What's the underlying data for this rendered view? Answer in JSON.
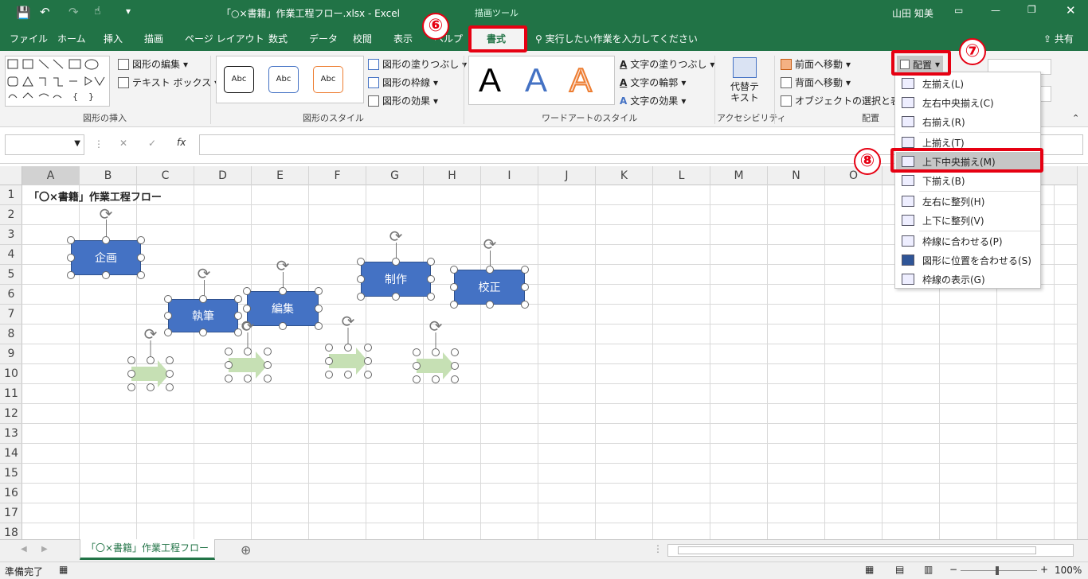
{
  "titlebar": {
    "filename": "「○×書籍」作業工程フロー.xlsx",
    "sep": "-",
    "app": "Excel",
    "context_tool": "描画ツール",
    "user": "山田 知美"
  },
  "tabs": [
    "ファイル",
    "ホーム",
    "挿入",
    "描画",
    "ページ レイアウト",
    "数式",
    "データ",
    "校閲",
    "表示",
    "ヘルプ",
    "書式"
  ],
  "tell_me": "実行したい作業を入力してください",
  "share": "共有",
  "ribbon": {
    "insert_shapes": {
      "edit_shape": "図形の編集",
      "text_box": "テキスト ボックス",
      "label": "図形の挿入"
    },
    "shape_styles": {
      "style_samples": [
        "Abc",
        "Abc",
        "Abc"
      ],
      "fill": "図形の塗りつぶし",
      "outline": "図形の枠線",
      "effects": "図形の効果",
      "label": "図形のスタイル"
    },
    "wordart": {
      "samples": [
        "A",
        "A",
        "A"
      ],
      "fill": "文字の塗りつぶし",
      "outline": "文字の輪郭",
      "effects": "文字の効果",
      "label": "ワードアートのスタイル"
    },
    "accessibility": {
      "alt_text": "代替テキスト",
      "label": "アクセシビリティ"
    },
    "arrange": {
      "bring_forward": "前面へ移動",
      "send_backward": "背面へ移動",
      "selection_pane": "オブジェクトの選択と表示",
      "align": "配置",
      "label": "配置"
    }
  },
  "formula": {
    "fx": "fx"
  },
  "columns": [
    "A",
    "B",
    "C",
    "D",
    "E",
    "F",
    "G",
    "H",
    "I",
    "J",
    "K",
    "L",
    "M",
    "N",
    "O"
  ],
  "rows": [
    "1",
    "2",
    "3",
    "4",
    "5",
    "6",
    "7",
    "8",
    "9",
    "10",
    "11",
    "12",
    "13",
    "14",
    "15",
    "16",
    "17",
    "18"
  ],
  "sheet": {
    "a1_title": "「〇×書籍」作業工程フロー",
    "shapes": [
      "企画",
      "執筆",
      "編集",
      "制作",
      "校正"
    ]
  },
  "align_menu": [
    {
      "label": "左揃え(L)"
    },
    {
      "label": "左右中央揃え(C)"
    },
    {
      "label": "右揃え(R)"
    },
    {
      "label": "上揃え(T)"
    },
    {
      "label": "上下中央揃え(M)"
    },
    {
      "label": "下揃え(B)"
    },
    {
      "label": "左右に整列(H)"
    },
    {
      "label": "上下に整列(V)"
    },
    {
      "label": "枠線に合わせる(P)"
    },
    {
      "label": "図形に位置を合わせる(S)"
    },
    {
      "label": "枠線の表示(G)"
    }
  ],
  "callouts": [
    "⑥",
    "⑦",
    "⑧"
  ],
  "sheet_tab": "「〇×書籍」作業工程フロー",
  "status": {
    "ready": "準備完了",
    "zoom": "100%"
  },
  "colors": {
    "excel_green": "#217346",
    "shape_blue": "#4472c4",
    "arrow_green": "#c6e0b4",
    "highlight_red": "#e60012"
  }
}
